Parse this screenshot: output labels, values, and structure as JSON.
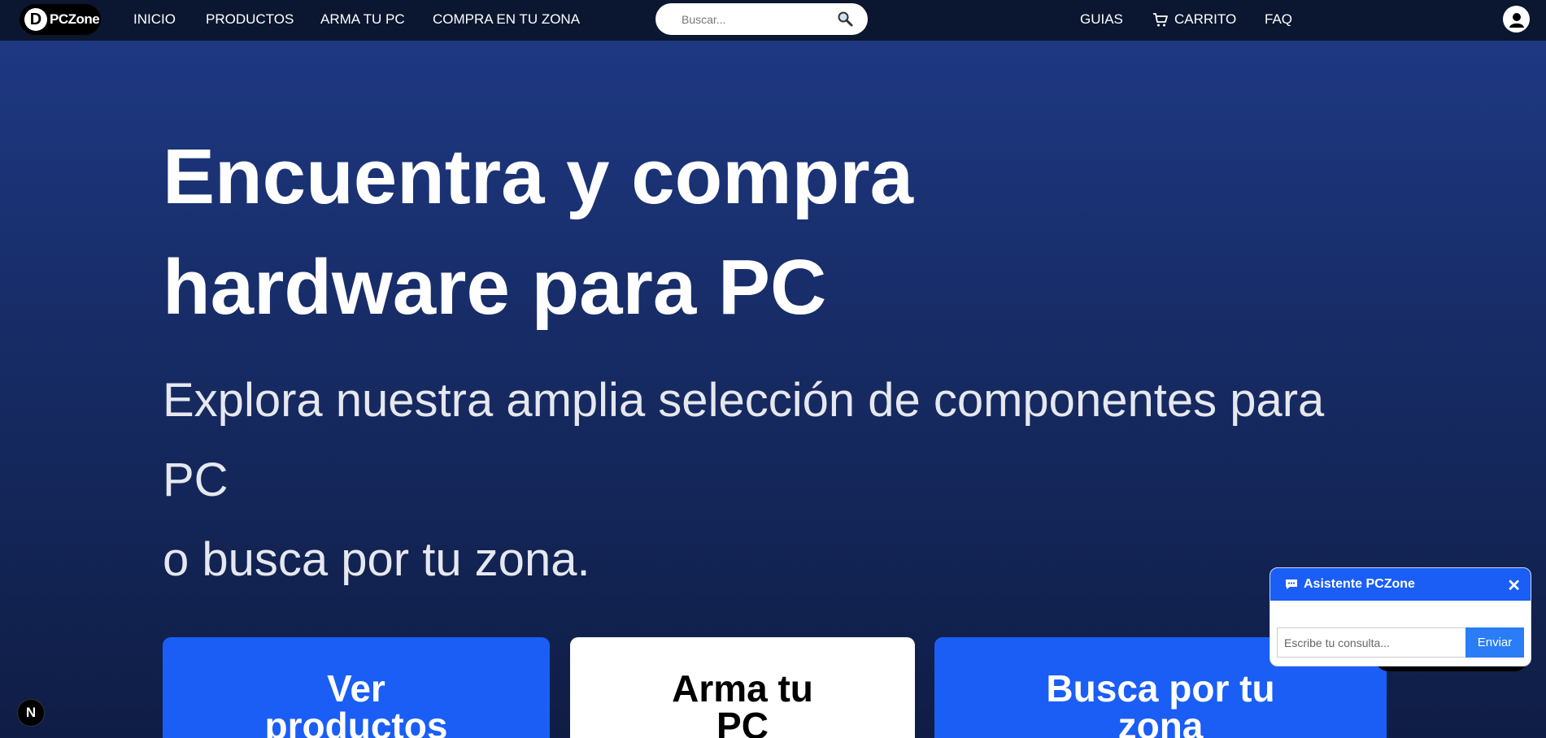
{
  "brand": {
    "logo_letter": "D",
    "name": "PCZone"
  },
  "nav": {
    "left": [
      "INICIO",
      "PRODUCTOS",
      "ARMA TU PC",
      "COMPRA EN TU ZONA"
    ],
    "guias": "GUIAS",
    "carrito": "CARRITO",
    "faq": "FAQ"
  },
  "search": {
    "placeholder": "Buscar...",
    "value": ""
  },
  "hero": {
    "title_line1": "Encuentra y compra",
    "title_line2": "hardware para PC",
    "subtitle_line1": "Explora nuestra amplia selección de componentes para",
    "subtitle_line2": "PC",
    "subtitle_line3": "o busca por tu zona."
  },
  "cards": [
    {
      "line1": "Ver",
      "line2": "productos"
    },
    {
      "line1": "Arma tu",
      "line2": "PC"
    },
    {
      "line1": "Busca por tu",
      "line2": "zona"
    }
  ],
  "next_badge": "N",
  "chat": {
    "title": "Asistente PCZone",
    "close": "✕",
    "input_placeholder": "Escribe tu consulta...",
    "send_label": "Enviar"
  },
  "colors": {
    "navbar": "#0b1730",
    "accent_blue": "#1a5ef5",
    "send_blue": "#2a7df6"
  }
}
